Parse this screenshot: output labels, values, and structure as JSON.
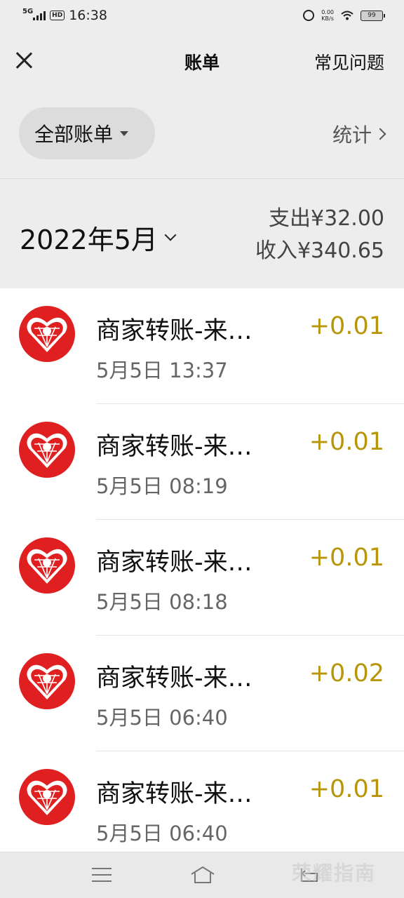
{
  "status_bar": {
    "network": "5G",
    "hd": "HD",
    "time": "16:38",
    "speed_value": "0.00",
    "speed_unit": "KB/s",
    "battery": "99"
  },
  "header": {
    "title": "账单",
    "faq": "常见问题"
  },
  "filter": {
    "all_bills": "全部账单",
    "stats": "统计"
  },
  "month": {
    "label": "2022年5月",
    "expense_label": "支出",
    "expense_value": "¥32.00",
    "income_label": "收入",
    "income_value": "¥340.65"
  },
  "transactions": [
    {
      "title": "商家转账-来…",
      "time": "5月5日 13:37",
      "amount": "+0.01",
      "icon": "pinduoduo-logo-icon"
    },
    {
      "title": "商家转账-来…",
      "time": "5月5日 08:19",
      "amount": "+0.01",
      "icon": "pinduoduo-logo-icon"
    },
    {
      "title": "商家转账-来…",
      "time": "5月5日 08:18",
      "amount": "+0.01",
      "icon": "pinduoduo-logo-icon"
    },
    {
      "title": "商家转账-来…",
      "time": "5月5日 06:40",
      "amount": "+0.02",
      "icon": "pinduoduo-logo-icon"
    },
    {
      "title": "商家转账-来…",
      "time": "5月5日 06:40",
      "amount": "+0.01",
      "icon": "pinduoduo-logo-icon"
    }
  ],
  "colors": {
    "amount": "#b8960a",
    "logo_red": "#e02020",
    "background": "#ededed"
  },
  "watermark": "荣耀指南"
}
